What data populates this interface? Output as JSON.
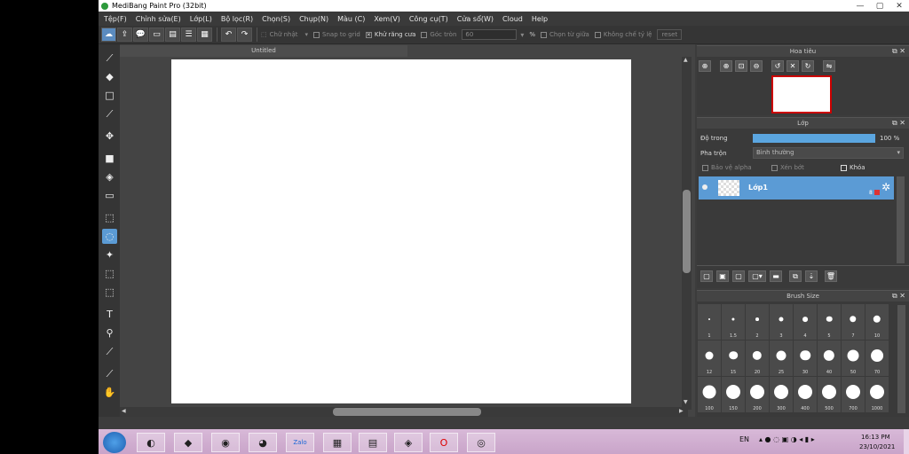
{
  "window": {
    "title": "MediBang Paint Pro (32bit)",
    "controls": [
      "—",
      "▢",
      "✕"
    ]
  },
  "menu": [
    "Tệp(F)",
    "Chỉnh sửa(E)",
    "Lớp(L)",
    "Bộ lọc(R)",
    "Chọn(S)",
    "Chụp(N)",
    "Màu (C)",
    "Xem(V)",
    "Công cụ(T)",
    "Cửa sổ(W)",
    "Cloud",
    "Help"
  ],
  "toolbar": {
    "shape_select": "Chữ nhật",
    "snap_to_grid": "Snap to grid",
    "antialias": "Khử răng cưa",
    "round_corner": "Góc tròn",
    "round_value": "60",
    "percent": "%",
    "select_center": "Chọn từ giữa",
    "fixed_ratio": "Không chế tỷ lệ",
    "reset": "reset"
  },
  "document": {
    "tab_title": "Untitled"
  },
  "navigator": {
    "title": "Hoa tiêu"
  },
  "layers": {
    "title": "Lớp",
    "opacity_label": "Độ trong",
    "opacity_value": "100 %",
    "opacity_fraction": 1.0,
    "blend_label": "Pha trộn",
    "blend_value": "Bình thường",
    "protect_alpha": "Bảo vệ alpha",
    "clipping": "Xén bớt",
    "lock": "Khóa",
    "layer_name": "Lớp1",
    "layer_bits": "8"
  },
  "brush_size": {
    "title": "Brush Size",
    "sizes": [
      "1",
      "1.5",
      "2",
      "3",
      "4",
      "5",
      "7",
      "10",
      "12",
      "15",
      "20",
      "25",
      "30",
      "40",
      "50",
      "70",
      "100",
      "150",
      "200",
      "300",
      "400",
      "500",
      "700",
      "1000"
    ]
  },
  "taskbar": {
    "lang": "EN",
    "time": "16:13 PM",
    "date": "23/10/2021",
    "zalo": "Zalo"
  },
  "colors": {
    "accent": "#5b9bd5",
    "bg": "#3c3c3c",
    "taskbar": "#d3b1d3"
  }
}
